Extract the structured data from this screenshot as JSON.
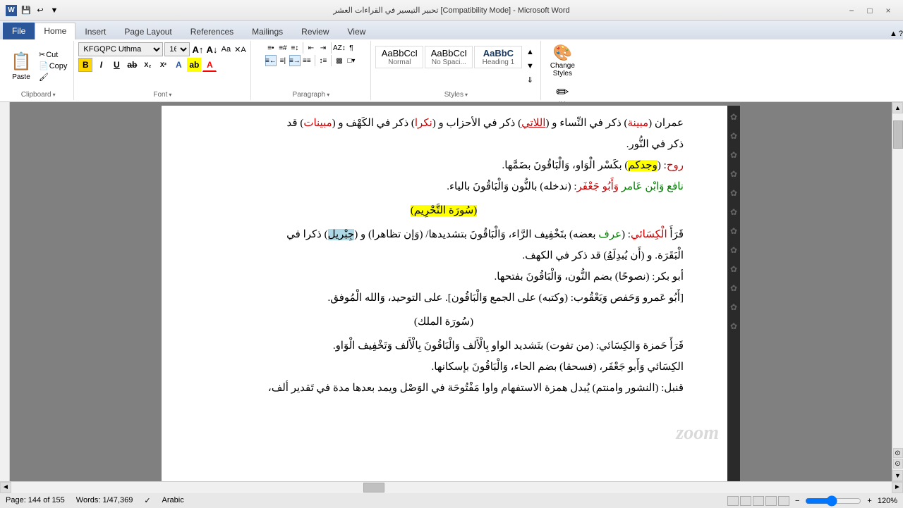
{
  "titleBar": {
    "appIcon": "W",
    "title": "تحبير التيسير في القراءات العشر [Compatibility Mode] - Microsoft Word",
    "controls": [
      "−",
      "□",
      "×"
    ]
  },
  "quickAccess": {
    "buttons": [
      "💾",
      "↩",
      "▼"
    ]
  },
  "ribbonTabs": [
    "File",
    "Home",
    "Insert",
    "Page Layout",
    "References",
    "Mailings",
    "Review",
    "View"
  ],
  "activeTab": "Home",
  "font": {
    "name": "KFGQPC Uthma",
    "size": "16",
    "increaseLabel": "A",
    "decreaseLabel": "A",
    "clearLabel": "A"
  },
  "clipboard": {
    "label": "Clipboard",
    "pasteLabel": "Paste"
  },
  "fontGroup": {
    "label": "Font"
  },
  "paragraphGroup": {
    "label": "Paragraph"
  },
  "stylesGroup": {
    "label": "Styles",
    "items": [
      {
        "label": "Normal",
        "preview": "AaBbCcI"
      },
      {
        "label": "No Spaci...",
        "preview": "AaBbCcI"
      },
      {
        "label": "Heading 1",
        "preview": "AaBbC"
      }
    ]
  },
  "changeStyles": {
    "label": "Change\nStyles"
  },
  "editing": {
    "label": "Editing"
  },
  "statusBar": {
    "page": "Page: 144 of 155",
    "words": "Words: 1/47,369",
    "lang": "Arabic",
    "zoom": "120%"
  },
  "arabicContent": {
    "line1": "عمران (مبينة) ذكر في النِّساء و (اللاتي) ذكر في الأحزاب و (نكرا) ذكر في الكهف و (مبينات) قد",
    "line2": "ذكر في النُّور.",
    "line3": "روح: (وجدكم) بكسر الواو، وَالْبَاقُونَ بضمها.",
    "line4": "نافع وَابن عامر وأبو جَعْفَر: (ندخله) بالنون وَالْبَاقُونَ بالياء.",
    "line5": "(سُورَة التَّحْرِيم)",
    "line6": "قَرَأَ الكسائي: (عرف بعضه) بتخفيف الرَّاء، وَالْبَاقُونَ بتشديدها/ (وإن تظاهرا) و (جِبْريل) ذكرا في",
    "line7": "البَقَرة. و (أَن يُبدلَهُ) قد ذكر في الكهف.",
    "line8": "أبو بكر: (نصوحًا) بضم النون، وَالْبَاقُونَ بفتحها.",
    "line9": "[أَبُو عَمرو وَحَفص وَيَعْقُوب: (وكتبه) على الجمع وَالْبَاقُون]. على التوحيد، وَالله الْمُوفق.",
    "line10": "(سُورَة الملك)",
    "line11": "قَرَأَ حَمزة والكسائي: (من تفوت) بتشديد الواو بالألف وَالْبَاقُونَ بِالْأَلف وَتَخْفيف الْوَاو.",
    "line12": "الكسائي وَأَبو جَعْفَر، (فسحقا) بضم الحاء، وَالْبَاقُونَ بإسكانها.",
    "line13": "قنبل: (النشور وامنتم) يُبدل همزة الاستفهام واوا مَفْتُوحَة في الوَصْل ويمد بعدها مدة في تَقدير ألف،"
  }
}
